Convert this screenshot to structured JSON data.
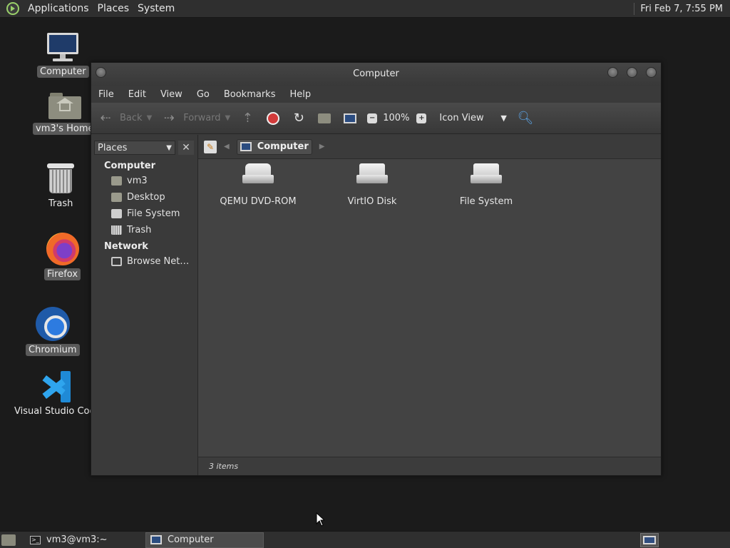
{
  "top_panel": {
    "menus": [
      "Applications",
      "Places",
      "System"
    ],
    "clock": "Fri Feb  7,  7:55 PM"
  },
  "desktop": {
    "icons": [
      {
        "label": "Computer",
        "icon": "monitor-icon"
      },
      {
        "label": "vm3's Home",
        "icon": "home-folder-icon"
      },
      {
        "label": "Trash",
        "icon": "trash-icon"
      },
      {
        "label": "Firefox",
        "icon": "firefox-icon"
      },
      {
        "label": "Chromium",
        "icon": "chromium-icon"
      },
      {
        "label": "Visual Studio Code",
        "icon": "vscode-icon"
      }
    ]
  },
  "window": {
    "title": "Computer",
    "menubar": [
      "File",
      "Edit",
      "View",
      "Go",
      "Bookmarks",
      "Help"
    ],
    "toolbar": {
      "back": "Back",
      "forward": "Forward",
      "zoom": "100%",
      "view": "Icon View"
    },
    "sidebar": {
      "selector": "Places",
      "groups": [
        {
          "title": "Computer",
          "items": [
            {
              "label": "vm3",
              "icon": "home-folder-icon"
            },
            {
              "label": "Desktop",
              "icon": "desktop-folder-icon"
            },
            {
              "label": "File System",
              "icon": "filesystem-icon"
            },
            {
              "label": "Trash",
              "icon": "trash-icon"
            }
          ]
        },
        {
          "title": "Network",
          "items": [
            {
              "label": "Browse Net…",
              "icon": "network-icon"
            }
          ]
        }
      ]
    },
    "path": {
      "current": "Computer"
    },
    "items": [
      {
        "label": "QEMU DVD-ROM",
        "icon": "optical-drive-icon"
      },
      {
        "label": "VirtIO Disk",
        "icon": "hard-disk-icon"
      },
      {
        "label": "File System",
        "icon": "hard-disk-icon"
      }
    ],
    "status": "3 items"
  },
  "bottom_panel": {
    "tasks": [
      "vm3@vm3:~",
      "Computer"
    ]
  }
}
